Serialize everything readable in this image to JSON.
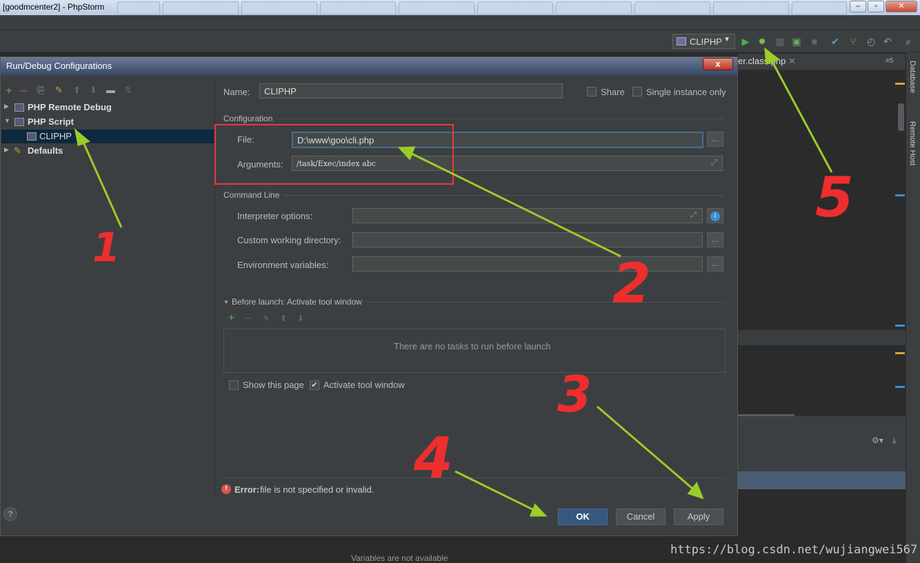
{
  "window": {
    "title": "[goodmcenter2] - PhpStorm"
  },
  "toolbar": {
    "run_config": "CLIPHP"
  },
  "editor": {
    "tab": "er.class.php",
    "status": "Variables are not available"
  },
  "right_strip": {
    "database": "Database",
    "remote_host": "Remote Host"
  },
  "dialog": {
    "title": "Run/Debug Configurations",
    "close": "x",
    "tree": [
      {
        "label": "PHP Remote Debug",
        "expanded": false
      },
      {
        "label": "PHP Script",
        "expanded": true
      },
      {
        "label": "CLIPHP",
        "selected": true
      },
      {
        "label": "Defaults",
        "expanded": false
      }
    ],
    "name_label": "Name:",
    "name_value": "CLIPHP",
    "share": "Share",
    "single_instance": "Single instance only",
    "config_section": "Configuration",
    "file_label": "File:",
    "file_value": "D:\\www\\goo\\cli.php",
    "args_label": "Arguments:",
    "args_value": "/task/Exec/index abc",
    "cmd_section": "Command Line",
    "interp_label": "Interpreter options:",
    "cwd_label": "Custom working directory:",
    "env_label": "Environment variables:",
    "before_launch": "Before launch: Activate tool window",
    "no_tasks": "There are no tasks to run before launch",
    "show_page": "Show this page",
    "activate_tool": "Activate tool window",
    "error_bold": "Error:",
    "error_text": "file is not specified or invalid.",
    "ok": "OK",
    "cancel": "Cancel",
    "apply": "Apply",
    "help": "?"
  },
  "annotations": [
    "1",
    "2",
    "3",
    "4",
    "5"
  ],
  "watermark": "https://blog.csdn.net/wujiangwei567"
}
